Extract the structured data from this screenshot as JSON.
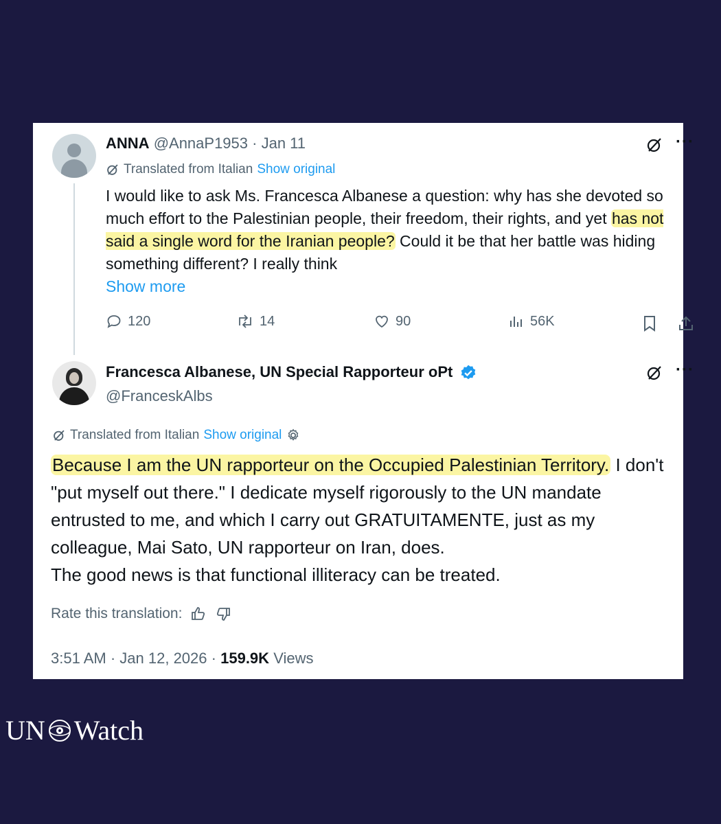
{
  "tweet1": {
    "name": "ANNA",
    "handle": "@AnnaP1953",
    "sep": "·",
    "date": "Jan 11",
    "translated_label": "Translated from Italian",
    "show_original": "Show original",
    "text_part1": "I would like to ask Ms. Francesca Albanese a question: why has she devoted so much effort to the Palestinian people, their freedom, their rights, and yet ",
    "text_highlight": "has not said a single word for the Iranian people?",
    "text_part2": " Could it be that her battle was hiding something different? I really think",
    "show_more": "Show more",
    "replies": "120",
    "reposts": "14",
    "likes": "90",
    "views": "56K"
  },
  "tweet2": {
    "name": "Francesca Albanese, UN Special Rapporteur oPt",
    "handle": "@FranceskAlbs",
    "translated_label": "Translated from Italian",
    "show_original": "Show original",
    "text_highlight": "Because I am the UN rapporteur on the Occupied Palestinian Territory.",
    "text_rest": " I don't \"put myself out there.\" I dedicate myself rigorously to the UN mandate entrusted to me, and which I carry out GRATUITAMENTE, just as my colleague, Mai Sato, UN rapporteur on Iran, does.",
    "text_line2": "The good news is that functional illiteracy can be treated.",
    "rate_label": "Rate this translation:",
    "time": "3:51 AM",
    "date": "Jan 12, 2026",
    "sep": "·",
    "views_count": "159.9K",
    "views_label": "Views"
  },
  "more_label": "···",
  "logo": {
    "left": "UN",
    "right": "Watch"
  },
  "colors": {
    "background": "#1b1940",
    "link": "#1d9bf0",
    "highlight": "#fbf5a3",
    "verified": "#1d9bf0"
  }
}
